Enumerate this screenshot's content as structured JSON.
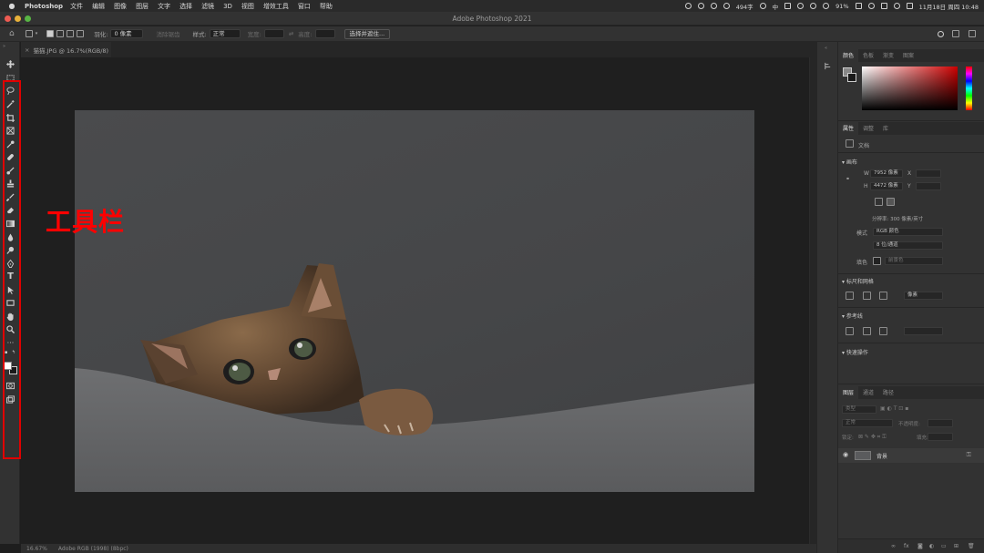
{
  "menubar": {
    "app": "Photoshop",
    "items": [
      "文件",
      "编辑",
      "图像",
      "图层",
      "文字",
      "选择",
      "滤镜",
      "3D",
      "视图",
      "增效工具",
      "窗口",
      "帮助"
    ],
    "status_text": "494字",
    "input_method": "中",
    "battery": "91%",
    "datetime": "11月18日 周四 10:48"
  },
  "window": {
    "title": "Adobe Photoshop 2021"
  },
  "options_bar": {
    "feather_label": "羽化:",
    "feather_value": "0 像素",
    "antialias": "消除锯齿",
    "style_label": "样式:",
    "style_value": "正常",
    "width_label": "宽度:",
    "height_label": "高度:",
    "select_subject": "选择并遮住..."
  },
  "document_tab": {
    "title": "猫猫.JPG @ 16.7%(RGB/8)"
  },
  "annotation": {
    "label": "工具栏"
  },
  "status_bar": {
    "zoom": "16.67%",
    "profile": "Adobe RGB (1998) (8bpc)"
  },
  "color_panel": {
    "tabs": [
      "颜色",
      "色板",
      "渐变",
      "图案"
    ]
  },
  "properties_panel": {
    "tabs": [
      "属性",
      "调整",
      "库"
    ],
    "doc_label": "文档",
    "canvas_section": "画布",
    "w_label": "W",
    "w_value": "7952 像素",
    "h_label": "H",
    "h_value": "4472 像素",
    "x_label": "X",
    "y_label": "Y",
    "resolution": "分辨率: 300 像素/英寸",
    "mode_label": "模式",
    "mode_value": "RGB 颜色",
    "depth_value": "8 位/通道",
    "fill_label": "填色",
    "fill_value": "前景色",
    "rulers_section": "标尺和网格",
    "units_value": "像素",
    "guides_section": "参考线",
    "quick_actions_section": "快速操作"
  },
  "layers_panel": {
    "tabs": [
      "图层",
      "通道",
      "路径"
    ],
    "kind_label": "类型",
    "blend_mode": "正常",
    "opacity_label": "不透明度:",
    "lock_label": "锁定:",
    "fill_label": "填充:",
    "layer_name": "背景"
  },
  "colors": {
    "annotation_red": "#ff0000",
    "traffic_close": "#ee5b52",
    "traffic_min": "#e8b13a",
    "traffic_max": "#58b544"
  }
}
